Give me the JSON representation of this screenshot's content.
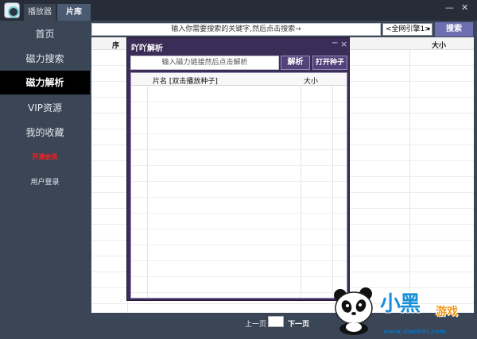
{
  "titlebar": {
    "tabs": [
      {
        "label": "播放器",
        "active": false
      },
      {
        "label": "片库",
        "active": true
      }
    ],
    "controls": {
      "minimize": "—",
      "close": "✕"
    }
  },
  "sidebar": {
    "items": [
      {
        "label": "首页",
        "active": false
      },
      {
        "label": "磁力搜索",
        "active": false
      },
      {
        "label": "磁力解析",
        "active": true
      },
      {
        "label": "VIP资源",
        "active": false
      },
      {
        "label": "我的收藏",
        "active": false
      },
      {
        "label": "开通会员",
        "active": false,
        "color": "#ff2020"
      },
      {
        "label": "用户登录",
        "active": false
      }
    ]
  },
  "search": {
    "placeholder": "输入你需要搜索的关键字,然后点击搜索→",
    "engine_selected": "<全网引擎1>",
    "button_label": "搜索"
  },
  "results": {
    "columns": {
      "seq": "序",
      "size": "大小"
    }
  },
  "pager": {
    "prev_label": "上一页",
    "next_label": "下一页"
  },
  "dialog": {
    "title": "吖吖解析",
    "controls": {
      "minimize": "−",
      "close": "×"
    },
    "magnet_placeholder": "输入磁力链接然后点击解析",
    "parse_button": "解析",
    "open_seed_button": "打开种子",
    "columns": {
      "name": "片名  [双击播放种子]",
      "size": "大小"
    }
  },
  "watermark": {
    "brand": "小黑",
    "sub": "游戏",
    "url": "www.xiaohei.com"
  },
  "colors": {
    "sidebar_bg": "#3a4556",
    "titlebar_bg": "#262d38",
    "accent": "#6d6fb0",
    "dialog_bg": "#3c2d58"
  }
}
